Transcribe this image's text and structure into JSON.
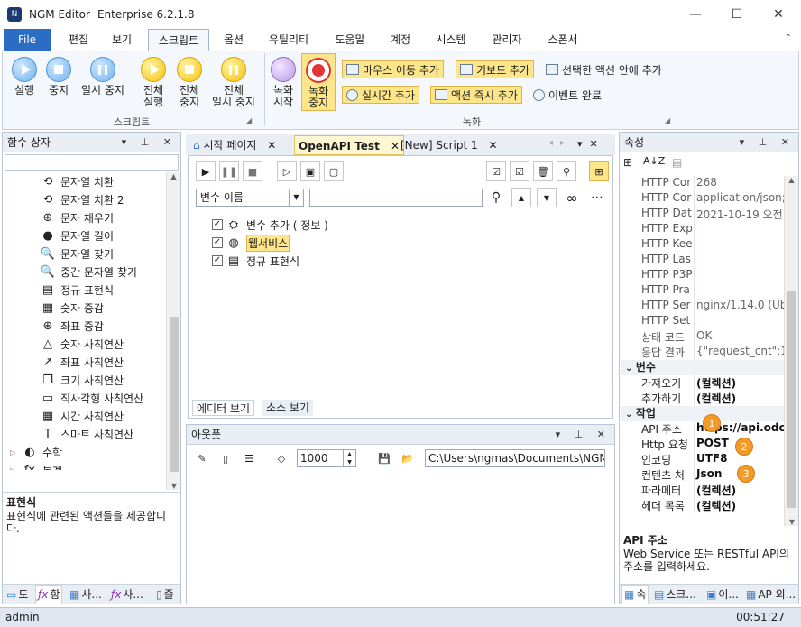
{
  "window": {
    "app_name": "NGM Editor",
    "edition": "Enterprise 6.2.1.8",
    "min_glyph": "—",
    "max_glyph": "☐",
    "close_glyph": "✕"
  },
  "ribbon": {
    "tabs": [
      "File",
      "편집",
      "보기",
      "스크립트",
      "옵션",
      "유틸리티",
      "도움말",
      "계정",
      "시스템",
      "관리자",
      "스폰서"
    ],
    "script_group": {
      "buttons": [
        {
          "label": "실행",
          "icon": "play-icon"
        },
        {
          "label": "중지",
          "icon": "stop-icon"
        },
        {
          "label": "일시 중지",
          "icon": "pause-icon"
        },
        {
          "label": "전체\n실행",
          "icon": "play-all-icon"
        },
        {
          "label": "전체\n중지",
          "icon": "stop-all-icon"
        },
        {
          "label": "전체\n일시 중지",
          "icon": "pause-all-icon"
        }
      ],
      "label": "스크립트"
    },
    "record_group": {
      "record_start": "녹화\n시작",
      "record_stop": "녹화\n중지",
      "mouse_move": "마우스 이동 추가",
      "keyboard": "키보드 추가",
      "in_action": "선택한 액션 안에 추가",
      "realtime": "실시간 추가",
      "immediate": "액션 즉시 추가",
      "event_done": "이벤트 완료",
      "label": "녹화"
    }
  },
  "left_panel": {
    "title": "함수 상자",
    "search_value": "",
    "items": [
      {
        "label": "문자열 치환",
        "icon": "replace-icon",
        "glyph": "⟲"
      },
      {
        "label": "문자열 치환 2",
        "icon": "replace2-icon",
        "glyph": "⟲"
      },
      {
        "label": "문자 채우기",
        "icon": "crosshair-icon",
        "glyph": "⊕"
      },
      {
        "label": "문자열 길이",
        "icon": "ellipsis-circle-icon",
        "glyph": "●"
      },
      {
        "label": "문자열 찾기",
        "icon": "search-icon",
        "glyph": "🔍"
      },
      {
        "label": "중간 문자열 찾기",
        "icon": "search-icon",
        "glyph": "🔍"
      },
      {
        "label": "정규 표현식",
        "icon": "regex-icon",
        "glyph": "▤"
      },
      {
        "label": "숫자 증감",
        "icon": "blocks-icon",
        "glyph": "▦"
      },
      {
        "label": "좌표 증감",
        "icon": "target-icon",
        "glyph": "⊕"
      },
      {
        "label": "숫자 사칙연산",
        "icon": "triangle-icon",
        "glyph": "△"
      },
      {
        "label": "좌표 사칙연산",
        "icon": "external-link-icon",
        "glyph": "↗"
      },
      {
        "label": "크기 사칙연산",
        "icon": "copy-icon",
        "glyph": "❐"
      },
      {
        "label": "직사각형 사칙연산",
        "icon": "rectangle-icon",
        "glyph": "▭"
      },
      {
        "label": "시간 사칙연산",
        "icon": "calendar-icon",
        "glyph": "▦"
      },
      {
        "label": "스마트 사칙연산",
        "icon": "text-t-icon",
        "glyph": "T"
      }
    ],
    "groups": [
      {
        "label": "수학",
        "icon": "math-icon",
        "glyph": "◐"
      },
      {
        "label": "통계",
        "icon": "fx-icon",
        "glyph": "ƒx"
      }
    ],
    "desc_title": "표현식",
    "desc_text": "표현식에 관련된 액션들을 제공합니다.",
    "bottom_tabs": [
      "도",
      "함",
      "사...",
      "사...",
      "즐"
    ]
  },
  "editor": {
    "tabs": [
      {
        "label": "시작 페이지",
        "active": false
      },
      {
        "label": "OpenAPI Test",
        "active": true
      },
      {
        "label": "[New] Script 1",
        "active": false
      }
    ],
    "var_select": "변수 이름",
    "var_search": "",
    "tree": [
      {
        "label": "변수 추가 ( 정보 )",
        "icon": "variable-icon",
        "glyph": "⛭"
      },
      {
        "label": "웹서비스",
        "icon": "globe-icon",
        "glyph": "◍"
      },
      {
        "label": "정규 표현식",
        "icon": "regex-icon",
        "glyph": "▤"
      }
    ],
    "view_tabs": [
      "에디터 보기",
      "소스 보기"
    ]
  },
  "output": {
    "title": "아웃풋",
    "count": "1000",
    "path": "C:\\Users\\ngmas\\Documents\\NGM6\\"
  },
  "properties": {
    "title": "속성",
    "rows": [
      {
        "name": "HTTP Cor",
        "value": "268"
      },
      {
        "name": "HTTP Cor",
        "value": "application/json;"
      },
      {
        "name": "HTTP Dat",
        "value": "2021-10-19 오전"
      },
      {
        "name": "HTTP Exp",
        "value": ""
      },
      {
        "name": "HTTP Kee",
        "value": ""
      },
      {
        "name": "HTTP Las",
        "value": ""
      },
      {
        "name": "HTTP P3P",
        "value": ""
      },
      {
        "name": "HTTP Pra",
        "value": ""
      },
      {
        "name": "HTTP Ser",
        "value": "nginx/1.14.0 (Ubu"
      },
      {
        "name": "HTTP Set",
        "value": ""
      },
      {
        "name": "상태 코드",
        "value": "OK"
      },
      {
        "name": "응답 결과",
        "value": "{\"request_cnt\":1,"
      }
    ],
    "var_category": "변수",
    "var_rows": [
      {
        "name": "가져오기",
        "value": "(컬렉션)"
      },
      {
        "name": "추가하기",
        "value": "(컬렉션)"
      }
    ],
    "task_category": "작업",
    "task_rows": [
      {
        "name": "API 주소",
        "value": "https://api.odc"
      },
      {
        "name": "Http 요청",
        "value": "POST"
      },
      {
        "name": "인코딩",
        "value": "UTF8"
      },
      {
        "name": "컨텐츠 처",
        "value": "Json"
      },
      {
        "name": "파라메터",
        "value": "(컬렉션)"
      },
      {
        "name": "헤더 목록",
        "value": "(컬렉션)"
      }
    ],
    "badges": [
      "1",
      "2",
      "3"
    ],
    "desc_title": "API 주소",
    "desc_text": "Web Service 또는 RESTful API의 주소를 입력하세요.",
    "bottom_tabs": [
      "속",
      "스크...",
      "이...",
      "AP 외..."
    ]
  },
  "status": {
    "user": "admin",
    "time": "00:51:27"
  },
  "colors": {
    "accent": "#2b6cc4",
    "highlight": "#fde68a",
    "badge": "#f39a28"
  }
}
